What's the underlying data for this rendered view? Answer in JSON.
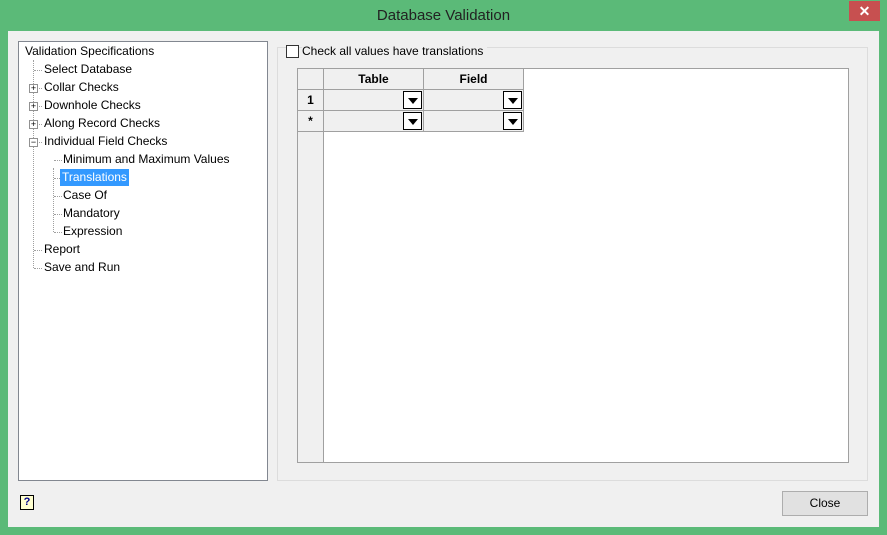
{
  "window": {
    "title": "Database Validation",
    "close_glyph": "✕"
  },
  "tree": {
    "root": "Validation Specifications",
    "items": [
      "Select Database",
      "Collar Checks",
      "Downhole Checks",
      "Along Record Checks",
      "Individual Field Checks"
    ],
    "sub_items": [
      "Minimum and Maximum Values",
      "Translations",
      "Case Of",
      "Mandatory",
      "Expression"
    ],
    "items_after": [
      "Report",
      "Save and Run"
    ],
    "selected": "Translations"
  },
  "options": {
    "check_translations_label": "Check all values have translations",
    "check_translations_checked": false
  },
  "grid": {
    "columns": [
      "Table",
      "Field"
    ],
    "rows": [
      {
        "header": "1",
        "table": "",
        "field": ""
      },
      {
        "header": "*",
        "table": "",
        "field": ""
      }
    ]
  },
  "footer": {
    "close_label": "Close",
    "help_glyph": "?"
  }
}
